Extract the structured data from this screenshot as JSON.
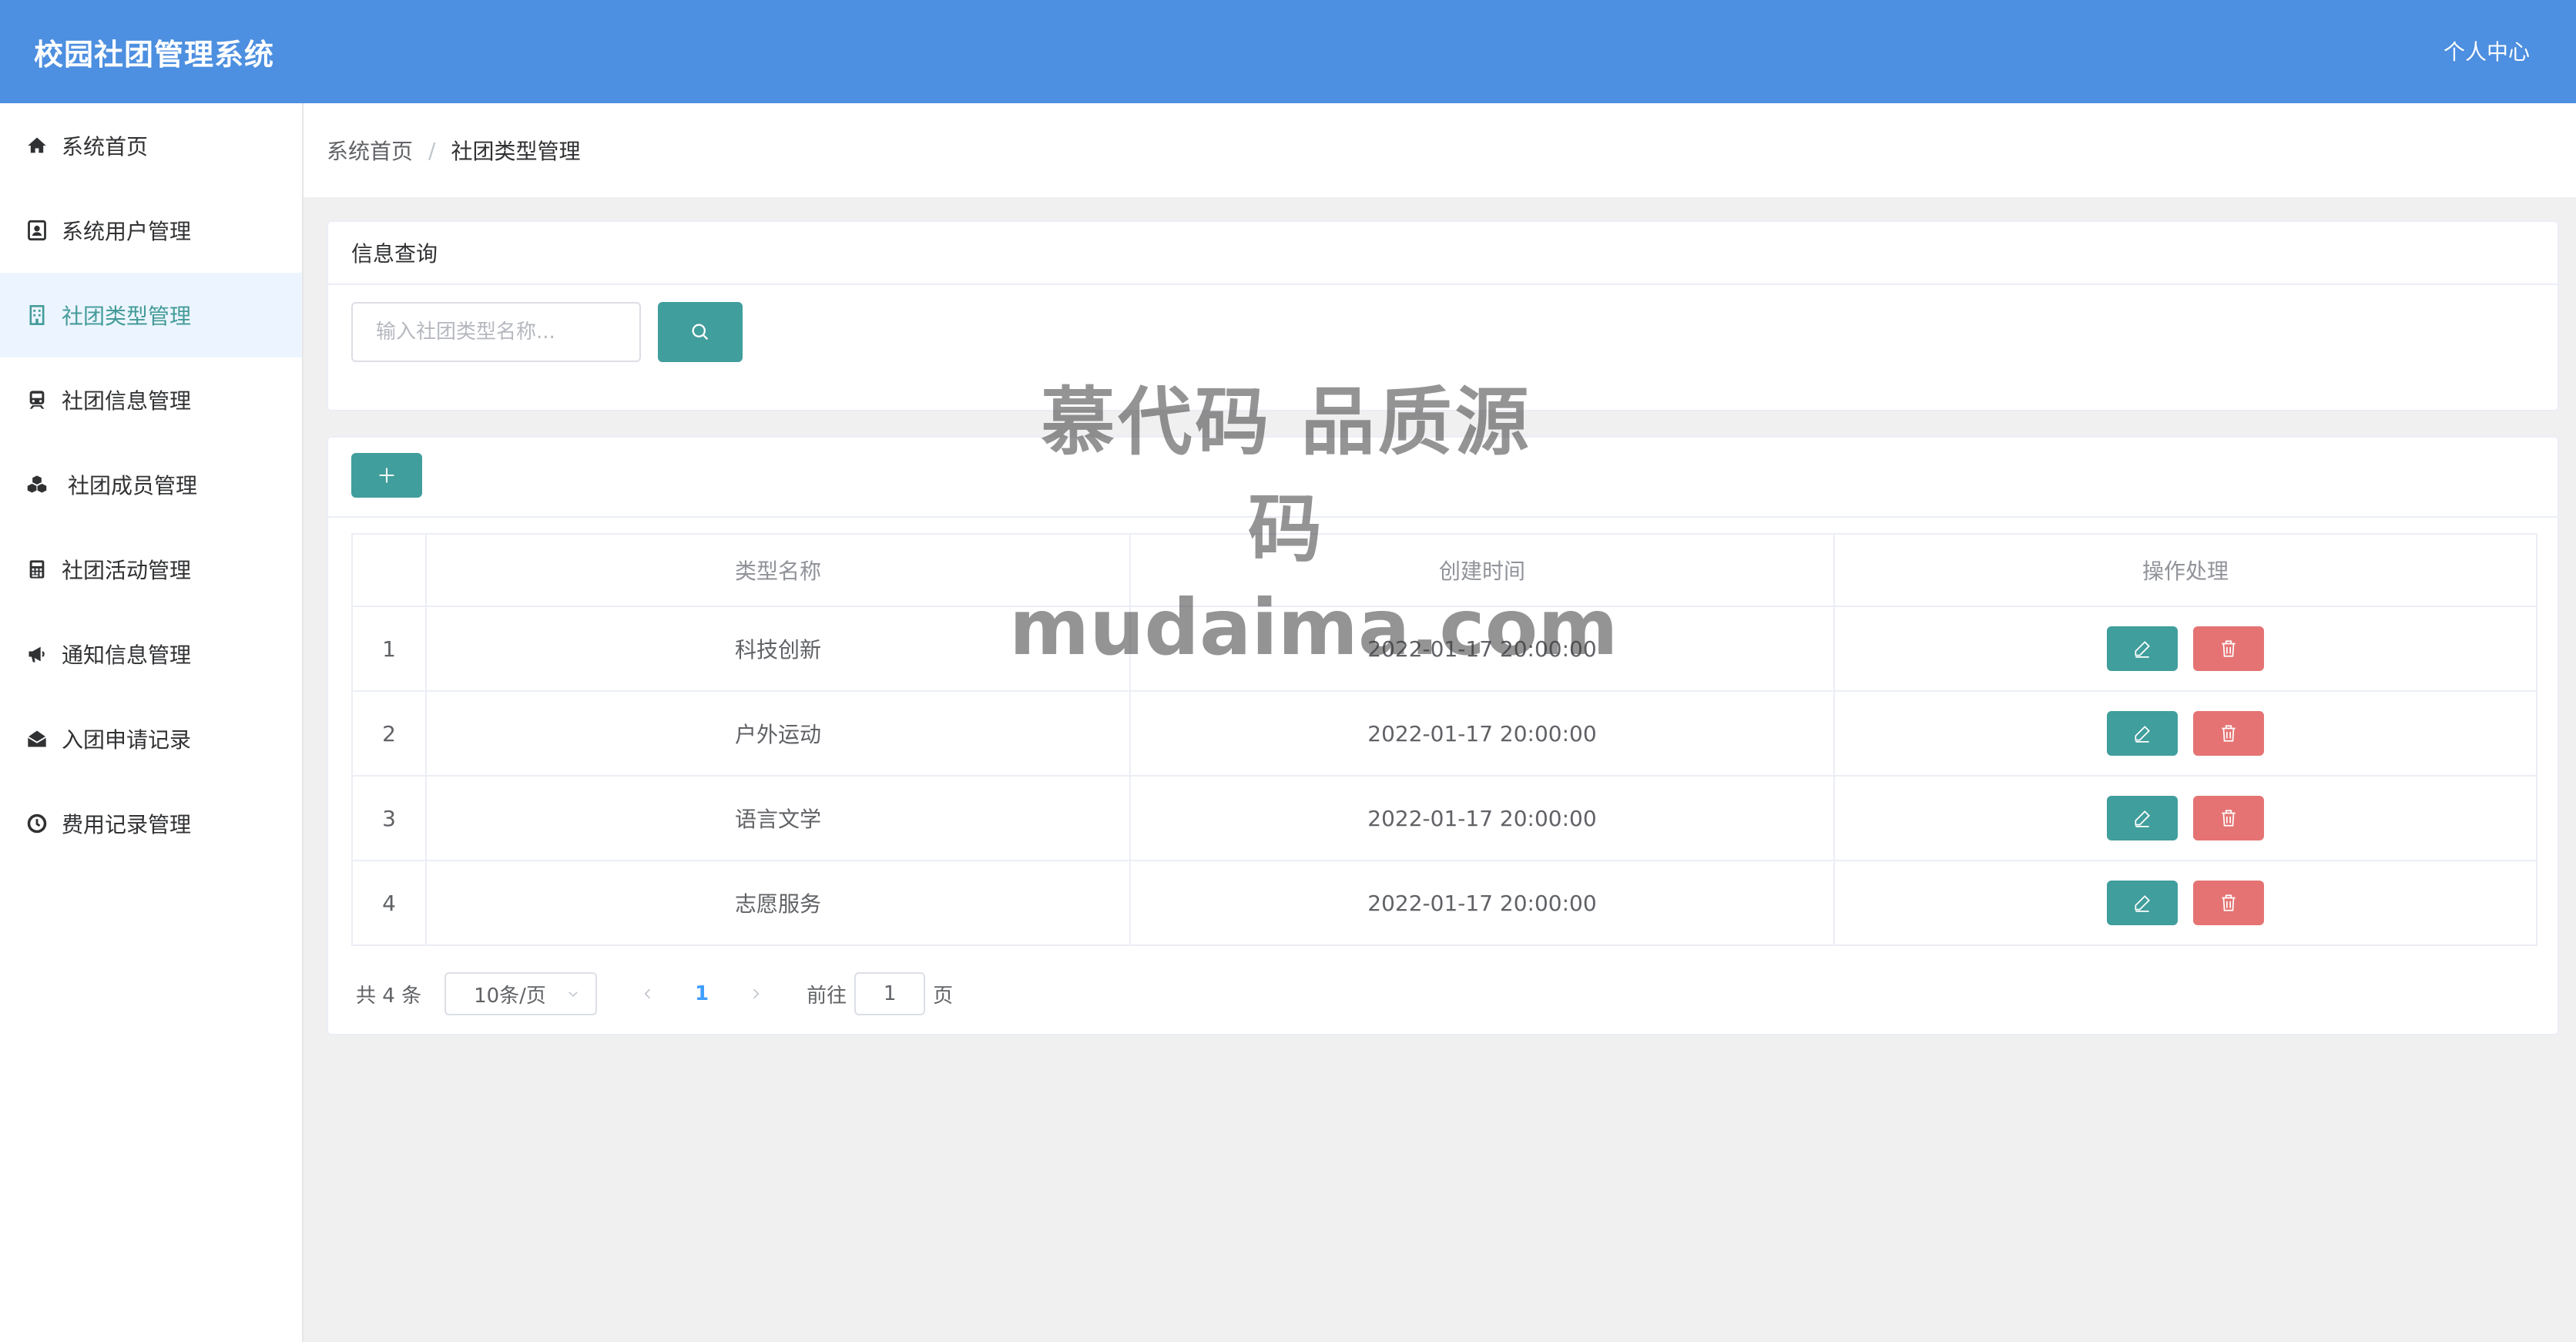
{
  "header": {
    "title": "校园社团管理系统",
    "user_center": "个人中心"
  },
  "sidebar": {
    "items": [
      {
        "label": "系统首页",
        "icon": "home-icon",
        "active": false
      },
      {
        "label": "系统用户管理",
        "icon": "user-card-icon",
        "active": false
      },
      {
        "label": "社团类型管理",
        "icon": "building-icon",
        "active": true
      },
      {
        "label": "社团信息管理",
        "icon": "train-icon",
        "active": false
      },
      {
        "label": "社团成员管理",
        "icon": "cubes-icon",
        "active": false
      },
      {
        "label": "社团活动管理",
        "icon": "calculator-icon",
        "active": false
      },
      {
        "label": "通知信息管理",
        "icon": "megaphone-icon",
        "active": false
      },
      {
        "label": "入团申请记录",
        "icon": "envelope-open-icon",
        "active": false
      },
      {
        "label": "费用记录管理",
        "icon": "clock-icon",
        "active": false
      }
    ]
  },
  "breadcrumb": {
    "home": "系统首页",
    "separator": "/",
    "current": "社团类型管理"
  },
  "query": {
    "title": "信息查询",
    "placeholder": "输入社团类型名称..."
  },
  "table": {
    "headers": [
      "",
      "类型名称",
      "创建时间",
      "操作处理"
    ],
    "rows": [
      {
        "idx": "1",
        "name": "科技创新",
        "created": "2022-01-17 20:00:00"
      },
      {
        "idx": "2",
        "name": "户外运动",
        "created": "2022-01-17 20:00:00"
      },
      {
        "idx": "3",
        "name": "语言文学",
        "created": "2022-01-17 20:00:00"
      },
      {
        "idx": "4",
        "name": "志愿服务",
        "created": "2022-01-17 20:00:00"
      }
    ]
  },
  "pagination": {
    "total_text": "共 4 条",
    "page_size": "10条/页",
    "current_page": "1",
    "goto_label": "前往",
    "goto_value": "1",
    "page_unit": "页"
  },
  "watermark": {
    "line1": "慕代码 品质源码",
    "line2": "mudaima.com"
  },
  "colors": {
    "header_bg": "#4d8fe0",
    "accent": "#409e9c",
    "danger": "#e57373",
    "active_menu_bg": "#ecf5ff",
    "page_active": "#409eff"
  }
}
